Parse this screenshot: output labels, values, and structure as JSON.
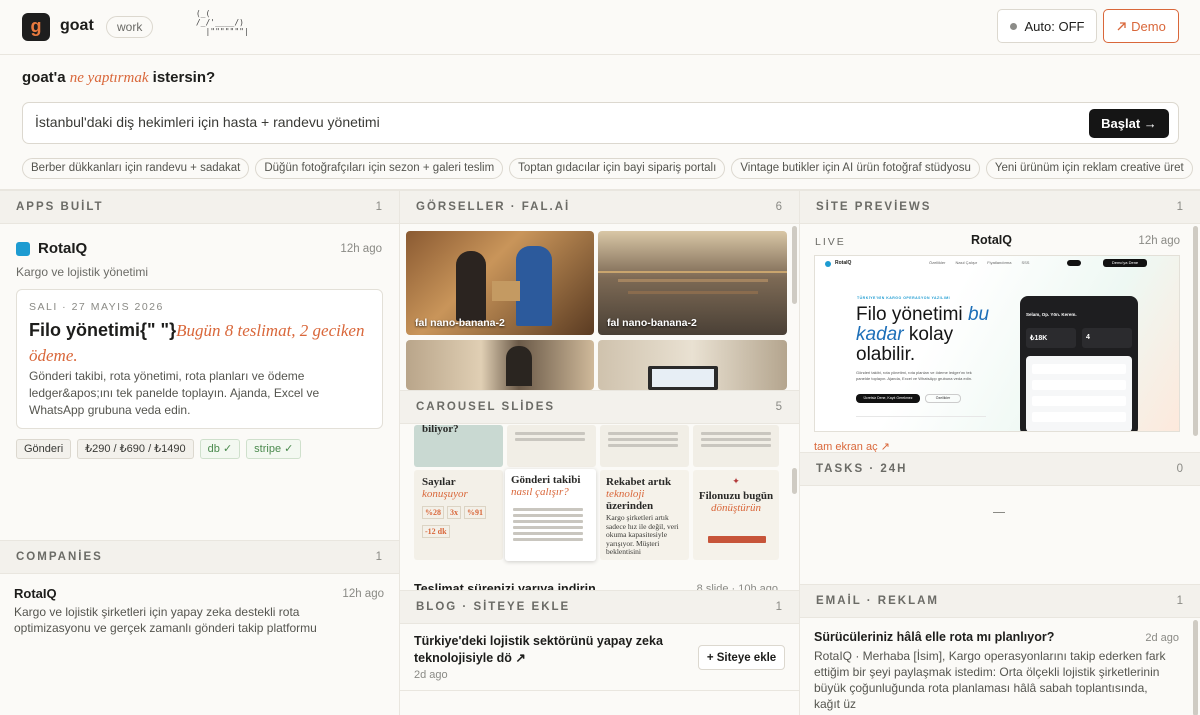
{
  "header": {
    "logo_letter": "g",
    "brand": "goat",
    "workspace": "work",
    "ascii_art": " (_(\n /_/'____/)\n   |\"\"\"\"\"\"\"|",
    "auto_label": "Auto: OFF",
    "demo_label": "Demo",
    "demo_icon": "arrow-up-right-icon"
  },
  "prompt": {
    "ask_prefix": "goat'a",
    "ask_accent": "ne yaptırmak",
    "ask_suffix": "istersin?",
    "value": "İstanbul'daki diş hekimleri için hasta + randevu yönetimi",
    "start_label": "Başlat →",
    "suggestions": [
      "Berber dükkanları için randevu + sadakat",
      "Düğün fotoğrafçıları için sezon + galeri teslim",
      "Toptan gıdacılar için bayi sipariş portalı",
      "Vintage butikler için AI ürün fotoğraf stüdyosu",
      "Yeni ürünüm için reklam creative üret"
    ]
  },
  "apps": {
    "title": "APPS BUİLT",
    "count": "1",
    "name": "RotaIQ",
    "time": "12h ago",
    "desc": "Kargo ve lojistik yönetimi",
    "card_date": "SALI · 27 MAYIS 2026",
    "card_head": "Filo yönetimi{\" \"}",
    "card_head_accent": "Bugün 8 teslimat, 2 geciken ödeme.",
    "card_body": "Gönderi takibi, rota yönetimi, rota planları ve ödeme ledger&apos;ını tek panelde toplayın. Ajanda, Excel ve WhatsApp grubuna veda edin.",
    "tags": [
      "Gönderi",
      "₺290 / ₺690 / ₺1490",
      "db ✓",
      "stripe ✓"
    ],
    "accent": "#1d9bd1"
  },
  "companies": {
    "title": "COMPANİES",
    "count": "1",
    "name": "RotaIQ",
    "time": "12h ago",
    "desc": "Kargo ve lojistik şirketleri için yapay zeka destekli rota optimizasyonu ve gerçek zamanlı gönderi takip platformu"
  },
  "gorseller": {
    "title": "GÖRSELLER · FAL.Aİ",
    "count": "6",
    "labels": [
      "fal nano-banana-2",
      "fal nano-banana-2"
    ]
  },
  "carousel": {
    "title": "CAROUSEL SLİDES",
    "count": "5",
    "top_text": "biliyor?",
    "s1_title": "Sayılar",
    "s1_accent": "konuşuyor",
    "s1_stats": [
      "%28",
      "3x",
      "%91",
      "-12 dk"
    ],
    "s2_title": "Gönderi takibi",
    "s2_accent": "nasıl çalışır?",
    "s3_title": "Rekabet artık",
    "s3_accent": "teknoloji",
    "s3_title2": "üzerinden",
    "s3_body": "Kargo şirketleri artık sadece hız ile değil, veri okuma kapasitesiyle yarışıyor. Müşteri beklentisini",
    "s4_title": "Filonuzu bugün",
    "s4_accent": "dönüştürün",
    "item_title": "Teslimat sürenizi yarıya indirin",
    "item_meta": "8 slide · 10h ago"
  },
  "blog": {
    "title": "BLOG · SİTEYE EKLE",
    "count": "1",
    "post_title": "Türkiye'deki lojistik sektörünü yapay zeka teknolojisiyle dö ↗",
    "post_time": "2d ago",
    "add_label": "+ Siteye ekle"
  },
  "site": {
    "title": "SİTE PREVİEWS",
    "count": "1",
    "live": "LIVE",
    "name": "RotaIQ",
    "time": "12h ago",
    "fullscreen": "tam ekran aç ↗",
    "preview": {
      "nav_brand": "RotaIQ",
      "nav_links": [
        "Özellikler",
        "Nasıl Çalışır",
        "Fiyatlandırma",
        "SSS"
      ],
      "nav_cta": "Demo'ya Dene",
      "eyebrow": "TÜRKİYE'NİN KARGO OPERASYON YAZILIMI",
      "hero_1": "Filo yönetimi",
      "hero_accent": "bu kadar",
      "hero_2": "kolay olabilir.",
      "hero_sub": "Gönderi takibi, rota yönetimi, rota planları ve ödeme ledger'ını tek panelde toplayın. Ajanda, Excel ve WhatsApp grubuna veda edin.",
      "cta_primary": "Ücretsiz Dene, Kayıt Gerekmez",
      "cta_secondary": "Özellikler",
      "phone_greeting": "Selam, Op. Yön. Kerem.",
      "phone_value": "₺18K",
      "phone_count": "4"
    }
  },
  "tasks": {
    "title": "TASKS · 24H",
    "count": "0",
    "empty": "—"
  },
  "email": {
    "title": "EMAİL · REKLAM",
    "count": "1",
    "subject": "Sürücüleriniz hâlâ elle rota mı planlıyor?",
    "time": "2d ago",
    "body": "RotaIQ · Merhaba [İsim], Kargo operasyonlarını takip ederken fark ettiğim bir şeyi paylaşmak istedim: Orta ölçekli lojistik şirketlerinin büyük çoğunluğunda rota planlaması hâlâ sabah toplantısında, kağıt üz"
  }
}
